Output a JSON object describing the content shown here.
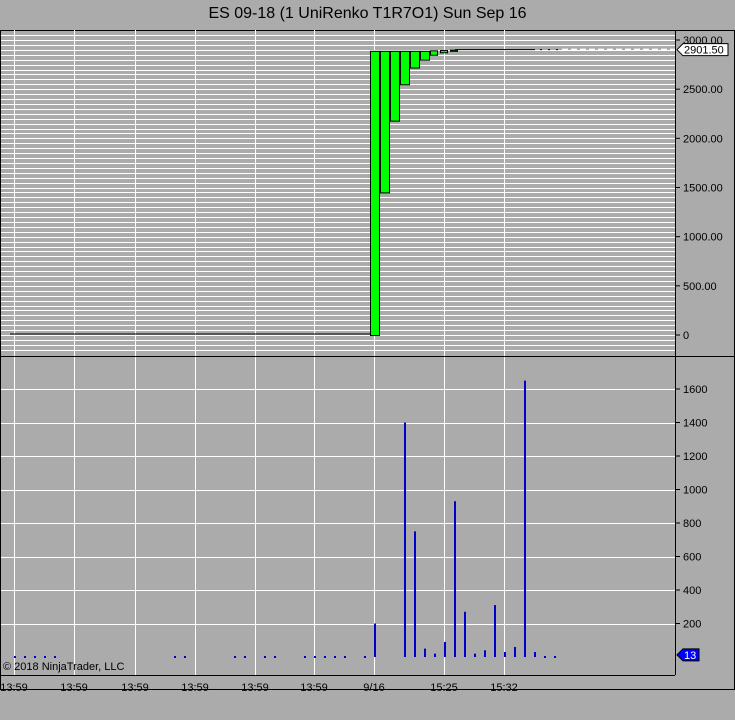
{
  "title": "ES 09-18 (1 UniRenko T1R7O1)  Sun  Sep  16",
  "copyright": "© 2018 NinjaTrader, LLC",
  "colors": {
    "up_bar": "#00ff00",
    "volume": "#0000cc",
    "background": "#ababab",
    "grid": "#ffffff"
  },
  "price_axis": {
    "ticks": [
      "3000.00",
      "2500.00",
      "2000.00",
      "1500.00",
      "1000.00",
      "500.00",
      "0"
    ],
    "values": [
      3000,
      2500,
      2000,
      1500,
      1000,
      500,
      0
    ],
    "last_price": "2901.50"
  },
  "volume_axis": {
    "ticks": [
      "1600",
      "1400",
      "1200",
      "1000",
      "800",
      "600",
      "400",
      "200"
    ],
    "values": [
      1600,
      1400,
      1200,
      1000,
      800,
      600,
      400,
      200
    ],
    "last_volume": "13"
  },
  "time_axis": [
    "13:59",
    "13:59",
    "13:59",
    "13:59",
    "13:59",
    "13:59",
    "9/16",
    "15:25",
    "15:32"
  ],
  "renko_bars": [
    {
      "open": 0,
      "close": 2890
    },
    {
      "open": 1450,
      "close": 2890
    },
    {
      "open": 2180,
      "close": 2890
    },
    {
      "open": 2550,
      "close": 2890
    },
    {
      "open": 2720,
      "close": 2890
    },
    {
      "open": 2800,
      "close": 2890
    },
    {
      "open": 2850,
      "close": 2895
    },
    {
      "open": 2875,
      "close": 2898
    },
    {
      "open": 2890,
      "close": 2901.5
    }
  ],
  "volumes": [
    5,
    5,
    5,
    5,
    5,
    0,
    0,
    0,
    0,
    0,
    0,
    0,
    0,
    0,
    0,
    0,
    5,
    5,
    0,
    0,
    0,
    0,
    5,
    5,
    0,
    5,
    5,
    0,
    0,
    5,
    5,
    5,
    5,
    5,
    0,
    5,
    200,
    0,
    0,
    1400,
    750,
    50,
    20,
    90,
    930,
    270,
    20,
    40,
    310,
    30,
    60,
    1650,
    30,
    5,
    5
  ]
}
